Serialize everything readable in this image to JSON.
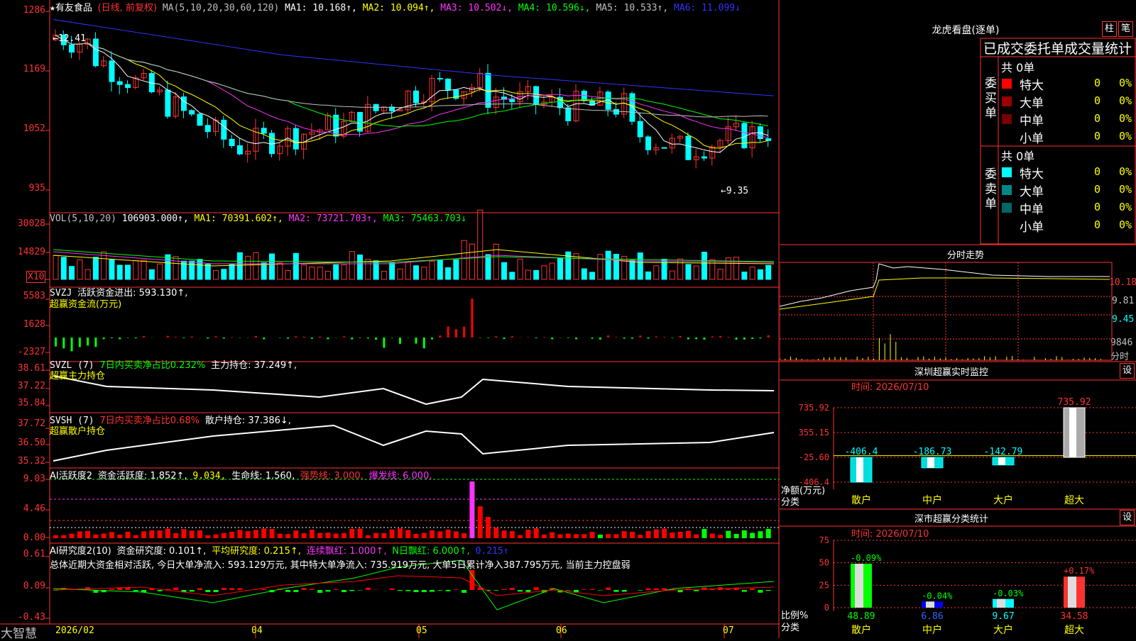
{
  "colors": {
    "up": "#ff3232",
    "down": "#00ffff",
    "ma1": "#ffffff",
    "ma2": "#ffff00",
    "ma3": "#ff33ff",
    "ma4": "#00ff00",
    "ma5": "#c0c0c0",
    "ma6": "#3333ff",
    "border": "#ff3232"
  },
  "main": {
    "stock_name": "有友食品",
    "period": "(日线, 前复权)",
    "ma_label": "MA(5,10,20,30,60,120)",
    "ma1": "MA1: 10.168↑,",
    "ma2": "MA2: 10.094↑,",
    "ma3": "MA3: 10.502↓,",
    "ma4": "MA4: 10.596↓,",
    "ma5": "MA5: 10.533↑,",
    "ma6": "MA6: 11.099↓",
    "ticks": [
      "1286",
      "1169",
      "1052",
      "935"
    ],
    "high_mark": "←12.41",
    "low_mark": "←9.35"
  },
  "vol": {
    "label": "VOL(5,10,20)",
    "value": "106903.000↑,",
    "ma1": "MA1: 70391.602↑,",
    "ma2": "MA2: 73721.703↑,",
    "ma3": "MA3: 75463.703↓",
    "ticks": [
      "30028",
      "14829"
    ],
    "unit": "X10"
  },
  "svzj": {
    "label": "SVZJ",
    "text1": "活跃资金进出: 593.130↑,",
    "text2": "超赢资金流(万元)",
    "ticks": [
      "5583",
      "1628",
      "-2327"
    ]
  },
  "svzl": {
    "label": "SVZL (7)",
    "text1": "7日内买卖净占比0.232%",
    "text2": "主力持仓: 37.249↑,",
    "text3": "超赢主力持仓",
    "ticks": [
      "38.61",
      "37.22",
      "35.84"
    ]
  },
  "svsh": {
    "label": "SVSH (7)",
    "text1": "7日内买卖净占比0.68%",
    "text2": "散户持仓: 37.386↓,",
    "text3": "超赢散户持仓",
    "ticks": [
      "37.72",
      "36.50",
      "35.32"
    ]
  },
  "ai1": {
    "label": "AI活跃度2",
    "text1": "资金活跃度: 1.852↑,",
    "text2": "9.034,",
    "text3": "生命线: 1.560,",
    "text4": "强势线: 3.000,",
    "text5": "爆发线: 6.000,",
    "ticks": [
      "9.03",
      "4.46",
      "0.00"
    ]
  },
  "ai2": {
    "label": "AI研究度2(10)",
    "text1": "资金研究度: 0.101↑,",
    "text2": "平均研究度: 0.215↑,",
    "text3": "连续飘红: 1.000↑,",
    "text4": "N日飘红: 6.000↑,",
    "text5": "0.215↑",
    "summary": "总体近期大资金相对活跃, 今日大单净流入: 593.129万元, 其中特大单净流入: 735.919万元, 大单5日累计净入387.795万元, 当前主力控盘弱",
    "ticks": [
      "0.61",
      "0.09",
      "-0.43"
    ]
  },
  "xaxis": {
    "brand": "大智慧",
    "labels": [
      "2026/02",
      "04",
      "05",
      "06",
      "07"
    ]
  },
  "right": {
    "lhb_title": "龙虎看盘(逐单)",
    "btn_zhu": "柱",
    "btn_bi": "笔",
    "stats_title": "已成交委托单成交量统计",
    "buy": {
      "side": "委买单",
      "total": "共 0单",
      "rows": [
        {
          "name": "特大",
          "count": "0",
          "pct": "0%",
          "color": "#ff0000"
        },
        {
          "name": "大单",
          "count": "0",
          "pct": "0%",
          "color": "#990000"
        },
        {
          "name": "中单",
          "count": "0",
          "pct": "0%",
          "color": "#770000"
        },
        {
          "name": "小单",
          "count": "0",
          "pct": "0%",
          "color": ""
        }
      ]
    },
    "sell": {
      "side": "委卖单",
      "total": "共 0单",
      "rows": [
        {
          "name": "特大",
          "count": "0",
          "pct": "0%",
          "color": "#00ffff"
        },
        {
          "name": "大单",
          "count": "0",
          "pct": "0%",
          "color": "#008888"
        },
        {
          "name": "中单",
          "count": "0",
          "pct": "0%",
          "color": "#006666"
        },
        {
          "name": "小单",
          "count": "0",
          "pct": "0%",
          "color": ""
        }
      ]
    },
    "fenshi": {
      "title": "分时走势",
      "ticks": [
        "10.18",
        "9.81",
        "9.45",
        "9846"
      ],
      "bottom": "分时"
    },
    "monitor": {
      "title": "深圳超赢实时监控",
      "btn": "设",
      "time": "时间: 2026/07/10",
      "ticks": [
        "735.92",
        "355.15",
        "-25.60",
        "-406.4"
      ],
      "axis_label": "净额(万元)",
      "axis_label2": "分类",
      "categories": [
        "散户",
        "中户",
        "大户",
        "超大"
      ],
      "values": [
        -406.4,
        -186.73,
        -142.79,
        735.92
      ],
      "labels": [
        "-406.4",
        "-186.73",
        "-142.79",
        "735.92"
      ]
    },
    "classify": {
      "title": "深市超赢分类统计",
      "btn": "设",
      "time": "时间: 2026/07/10",
      "ticks": [
        "75",
        "50",
        "25",
        "0"
      ],
      "axis_label": "比例%",
      "axis_label2": "分类",
      "categories": [
        "散户",
        "中户",
        "大户",
        "超大"
      ],
      "values": [
        48.89,
        6.86,
        9.67,
        34.58
      ],
      "labels": [
        "48.89",
        "6.86",
        "9.67",
        "34.58"
      ],
      "changes": [
        "-0.09%",
        "-0.04%",
        "-0.03%",
        "+0.17%"
      ]
    }
  },
  "chart_data": [
    {
      "type": "bar",
      "title": "深圳超赢实时监控",
      "ylabel": "净额(万元)",
      "categories": [
        "散户",
        "中户",
        "大户",
        "超大"
      ],
      "values": [
        -406.4,
        -186.73,
        -142.79,
        735.92
      ],
      "ylim": [
        -406.4,
        735.92
      ]
    },
    {
      "type": "bar",
      "title": "深市超赢分类统计",
      "ylabel": "比例%",
      "categories": [
        "散户",
        "中户",
        "大户",
        "超大"
      ],
      "values": [
        48.89,
        6.86,
        9.67,
        34.58
      ],
      "ylim": [
        0,
        75
      ]
    }
  ]
}
